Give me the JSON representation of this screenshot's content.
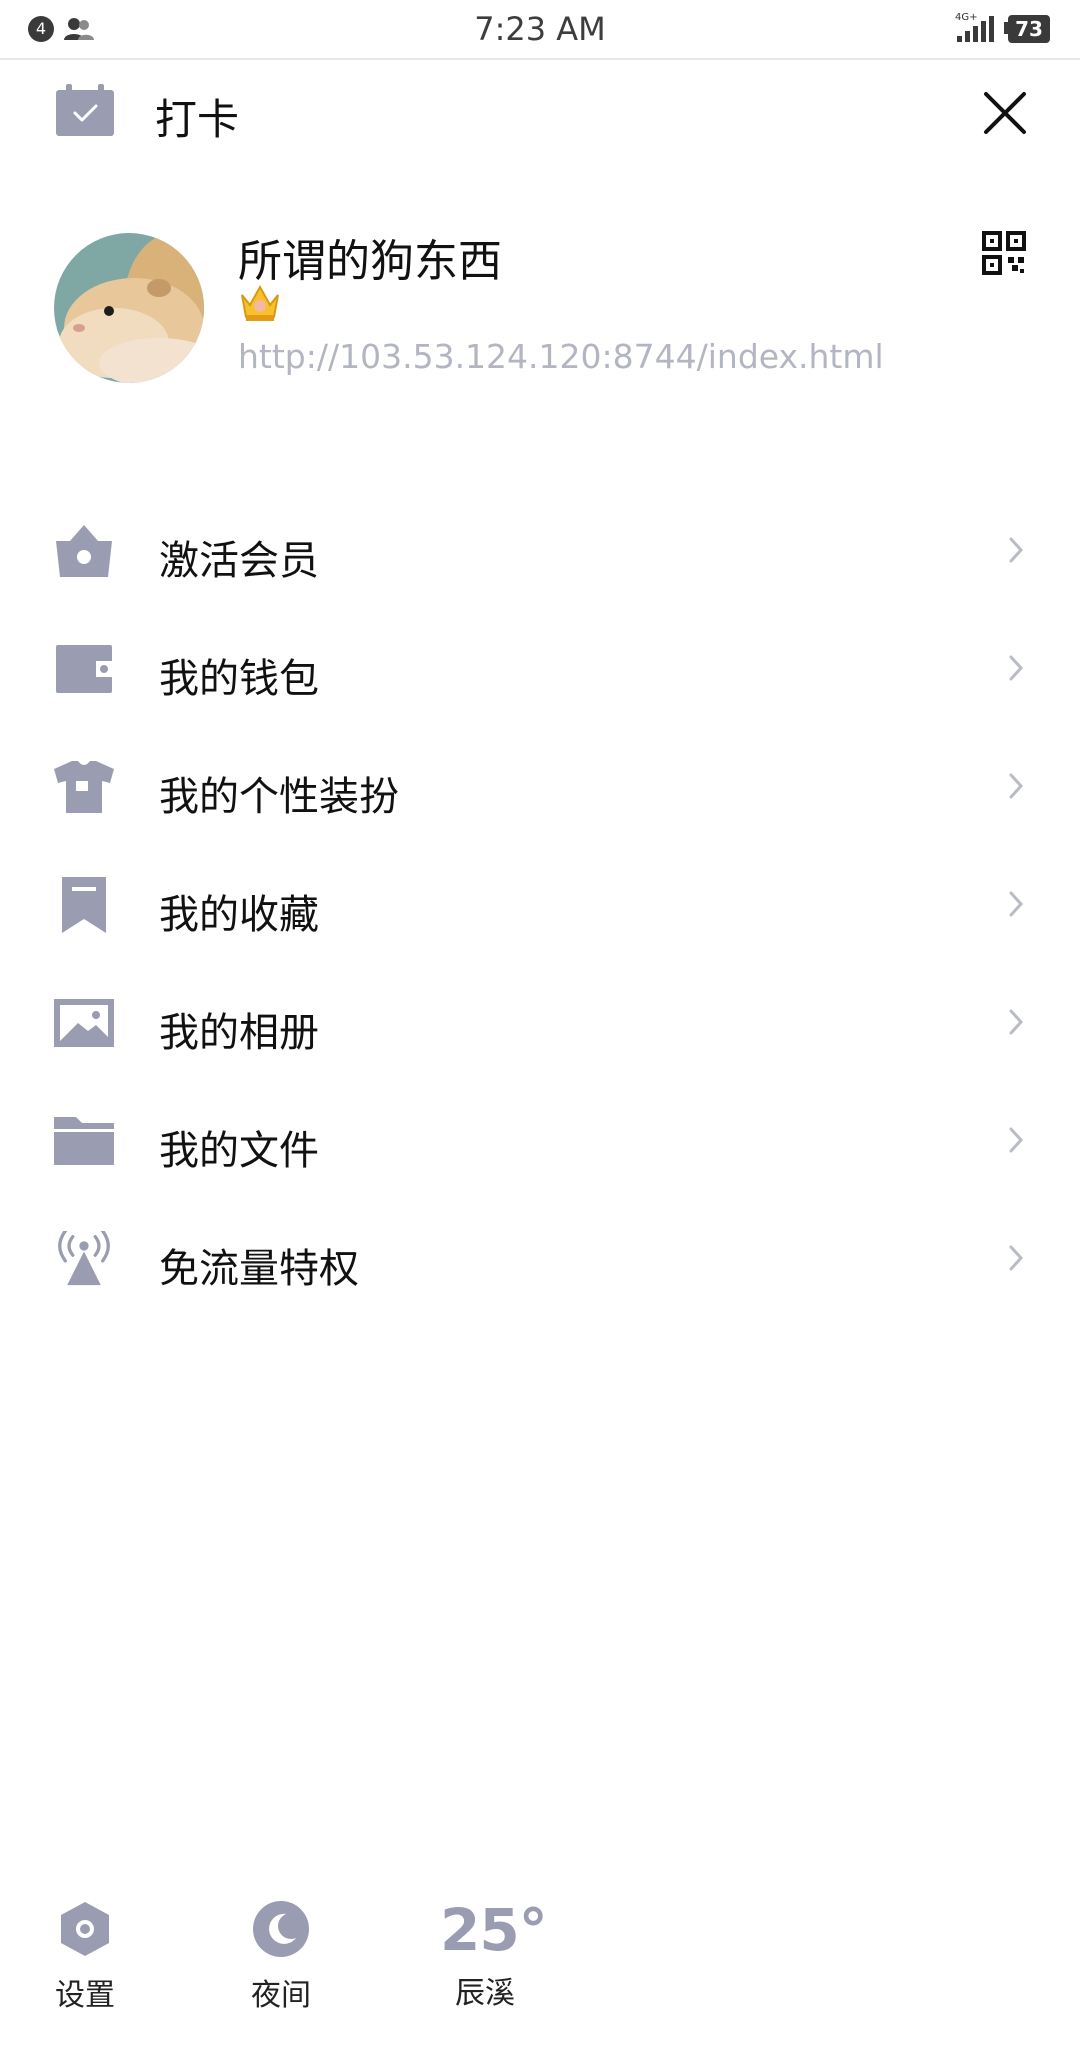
{
  "status_bar": {
    "notification_count": "4",
    "time": "7:23 AM",
    "network": "4G+",
    "battery": "73"
  },
  "header": {
    "checkin_label": "打卡"
  },
  "profile": {
    "username": "所谓的狗东西",
    "url": "http://103.53.124.120:8744/index.html",
    "badges": [
      "crown-icon",
      "moon-icon",
      "moon-icon"
    ]
  },
  "menu": {
    "items": [
      {
        "label": "激活会员",
        "icon": "vip-crown-icon"
      },
      {
        "label": "我的钱包",
        "icon": "wallet-icon"
      },
      {
        "label": "我的个性装扮",
        "icon": "shirt-icon"
      },
      {
        "label": "我的收藏",
        "icon": "bookmark-icon"
      },
      {
        "label": "我的相册",
        "icon": "photo-icon"
      },
      {
        "label": "我的文件",
        "icon": "folder-icon"
      },
      {
        "label": "免流量特权",
        "icon": "signal-tower-icon"
      }
    ]
  },
  "bottom": {
    "settings_label": "设置",
    "night_label": "夜间",
    "weather_temp": "25°",
    "weather_city": "辰溪"
  },
  "colors": {
    "icon_gray": "#9a9db2",
    "url_gray": "#b3b6c2",
    "chevron_gray": "#b9bcc6"
  }
}
